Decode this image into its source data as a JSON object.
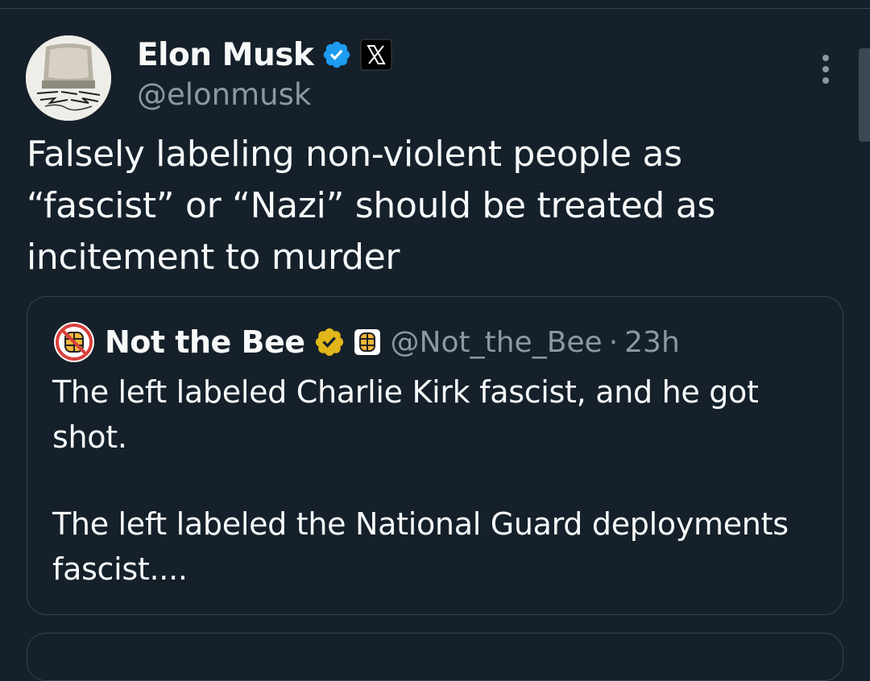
{
  "tweet": {
    "author": {
      "name": "Elon Musk",
      "handle": "@elonmusk",
      "verified_color": "#1d9bf0",
      "affiliation_icon": "x-logo-icon"
    },
    "text": "Falsely labeling non-violent people as “fascist” or “Nazi” should be treated as incitement to murder",
    "more_icon": "more-vertical-icon"
  },
  "quote": {
    "author": {
      "name": "Not the Bee",
      "handle": "@Not_the_Bee",
      "verified_color": "#e2b719",
      "separator": "·",
      "time": "23h"
    },
    "paragraphs": [
      "The left labeled Charlie Kirk fascist, and he got shot.",
      "The left labeled the National Guard deployments fascist...."
    ]
  },
  "colors": {
    "background": "#15202b",
    "border": "#38444d",
    "secondary_text": "#8b98a5"
  }
}
